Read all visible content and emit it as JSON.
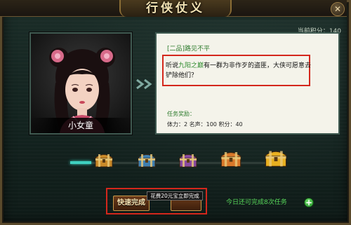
{
  "window": {
    "title": "行侠仗义",
    "close_icon": "close-icon"
  },
  "points": {
    "label": "当前积分：",
    "value": "140"
  },
  "npc": {
    "name": "小女童"
  },
  "quest": {
    "grade_name": "[二品]路见不平",
    "desc_prefix": "听说",
    "desc_link": "九阳之巅",
    "desc_suffix": "有一群为非作歹的盗匪，大侠可愿意去",
    "desc_line2": "铲除他们？",
    "rewards_label": "任务奖励：",
    "rewards": "体力：2   名声：100   积分：40"
  },
  "chests": [
    {
      "name": "bronze-chest-icon",
      "color": "#c98a2a"
    },
    {
      "name": "blue-chest-icon",
      "color": "#3f7fb0"
    },
    {
      "name": "purple-chest-icon",
      "color": "#8a4aa0"
    },
    {
      "name": "orange-chest-icon",
      "color": "#d8782a"
    },
    {
      "name": "gold-chest-icon",
      "color": "#e8b020"
    }
  ],
  "progress": {
    "filled_fraction": 0.1
  },
  "buttons": {
    "quick_complete": "快速完成",
    "second": ""
  },
  "tooltip": "花费20元宝立即完成",
  "daily": {
    "text": "今日还可完成8次任务",
    "plus": "+"
  },
  "colors": {
    "highlight": "#d4271c",
    "accent_green": "#58d85a",
    "track": "#3fd0c0"
  }
}
